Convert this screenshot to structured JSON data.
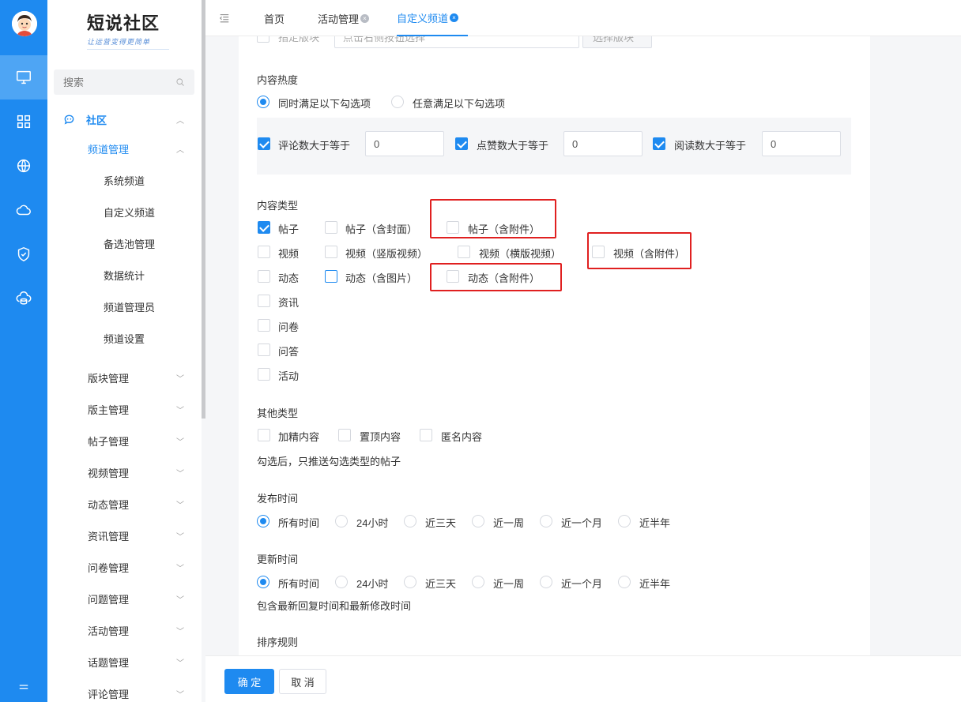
{
  "app": {
    "logo_title": "短说社区",
    "logo_slogan": "让运营变得更简单"
  },
  "search": {
    "placeholder": "搜索"
  },
  "menu": {
    "community": "社区",
    "channel_mgmt": "频道管理",
    "sub_items": [
      "系统频道",
      "自定义频道",
      "备选池管理",
      "数据统计",
      "频道管理员",
      "频道设置"
    ],
    "groups": [
      "版块管理",
      "版主管理",
      "帖子管理",
      "视频管理",
      "动态管理",
      "资讯管理",
      "问卷管理",
      "问题管理",
      "活动管理",
      "话题管理",
      "评论管理"
    ]
  },
  "tabs": [
    {
      "label": "首页"
    },
    {
      "label": "活动管理"
    },
    {
      "label": "自定义频道"
    }
  ],
  "form": {
    "top_partial_label": "指定版块",
    "top_partial_input": "点击右侧按钮选择",
    "top_partial_button": "选择版块",
    "heat": {
      "label": "内容热度",
      "radio_all": "同时满足以下勾选项",
      "radio_any": "任意满足以下勾选项",
      "comments_label": "评论数大于等于",
      "comments_value": "0",
      "likes_label": "点赞数大于等于",
      "likes_value": "0",
      "reads_label": "阅读数大于等于",
      "reads_value": "0"
    },
    "content_type": {
      "label": "内容类型",
      "post": "帖子",
      "post_cover": "帖子（含封面）",
      "post_attach": "帖子（含附件）",
      "video": "视频",
      "video_vertical": "视频（竖版视频）",
      "video_horizontal": "视频（横版视频）",
      "video_attach": "视频（含附件）",
      "moment": "动态",
      "moment_image": "动态（含图片）",
      "moment_attach": "动态（含附件）",
      "news": "资讯",
      "survey": "问卷",
      "qa": "问答",
      "activity": "活动"
    },
    "other_type": {
      "label": "其他类型",
      "featured": "加精内容",
      "pinned": "置顶内容",
      "anonymous": "匿名内容",
      "hint": "勾选后，只推送勾选类型的帖子"
    },
    "publish_time": {
      "label": "发布时间",
      "options": [
        "所有时间",
        "24小时",
        "近三天",
        "近一周",
        "近一个月",
        "近半年"
      ]
    },
    "update_time": {
      "label": "更新时间",
      "options": [
        "所有时间",
        "24小时",
        "近三天",
        "近一周",
        "近一个月",
        "近半年"
      ],
      "hint": "包含最新回复时间和最新修改时间"
    },
    "sort_label": "排序规则"
  },
  "footer": {
    "confirm": "确 定",
    "cancel": "取 消"
  },
  "colors": {
    "accent": "#1e8af0",
    "highlight": "#e02020"
  }
}
